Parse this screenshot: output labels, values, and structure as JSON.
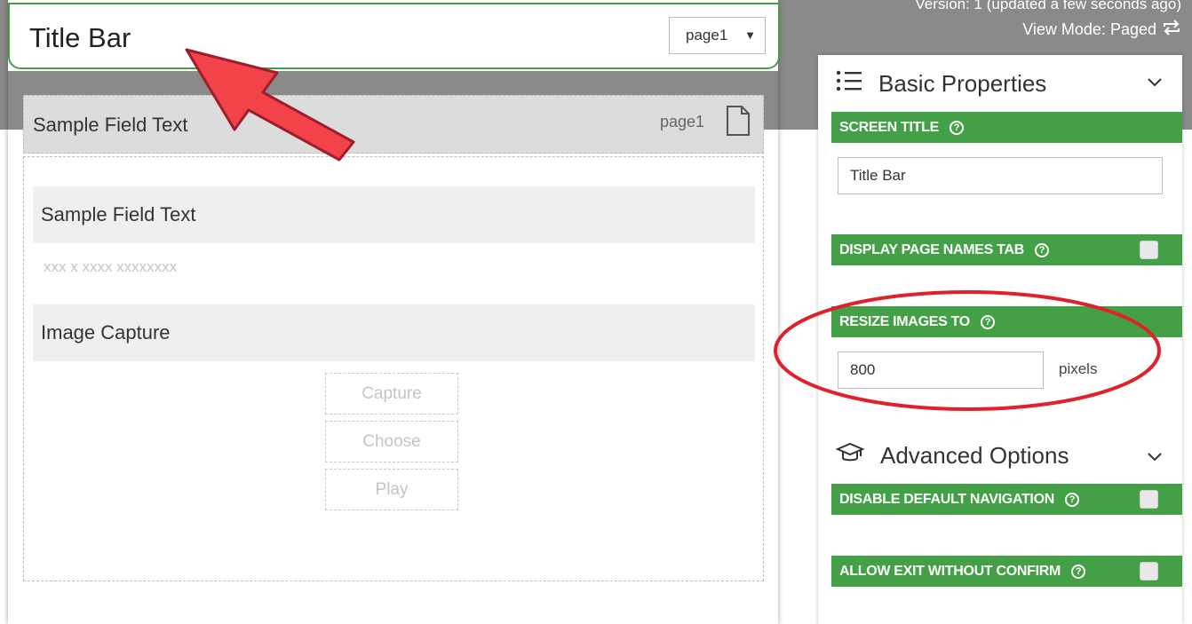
{
  "header": {
    "version_text": "Version: 1 (updated a few seconds ago)",
    "view_mode_text": "View Mode: Paged"
  },
  "canvas": {
    "title": "Title Bar",
    "page_select": "page1",
    "field_header": {
      "label": "Sample Field Text",
      "page": "page1"
    },
    "fields": {
      "text_label": "Sample Field Text",
      "text_placeholder": "xxx x xxxx xxxxxxxx",
      "image_label": "Image  Capture",
      "buttons": [
        "Capture",
        "Choose",
        "Play"
      ]
    }
  },
  "panel": {
    "basic": {
      "heading": "Basic Properties",
      "screen_title_label": "SCREEN TITLE",
      "screen_title_value": "Title Bar",
      "display_page_names_label": "DISPLAY PAGE NAMES TAB",
      "display_page_names_checked": false,
      "resize_images_label": "RESIZE IMAGES TO",
      "resize_images_value": "800",
      "resize_images_unit": "pixels"
    },
    "advanced": {
      "heading": "Advanced Options",
      "disable_nav_label": "DISABLE DEFAULT NAVIGATION",
      "disable_nav_checked": false,
      "allow_exit_label": "ALLOW EXIT WITHOUT CONFIRM",
      "allow_exit_checked": false
    }
  },
  "colors": {
    "accent_green": "#43a047",
    "annotation_red": "#e53935",
    "arrow_red": "#f2434a",
    "gray_bg": "#8a8a8a"
  },
  "icons": [
    "document-icon",
    "list-icon",
    "graduation-cap-icon",
    "chevron-down-icon",
    "repeat-icon",
    "help-icon",
    "caret-down-icon"
  ]
}
